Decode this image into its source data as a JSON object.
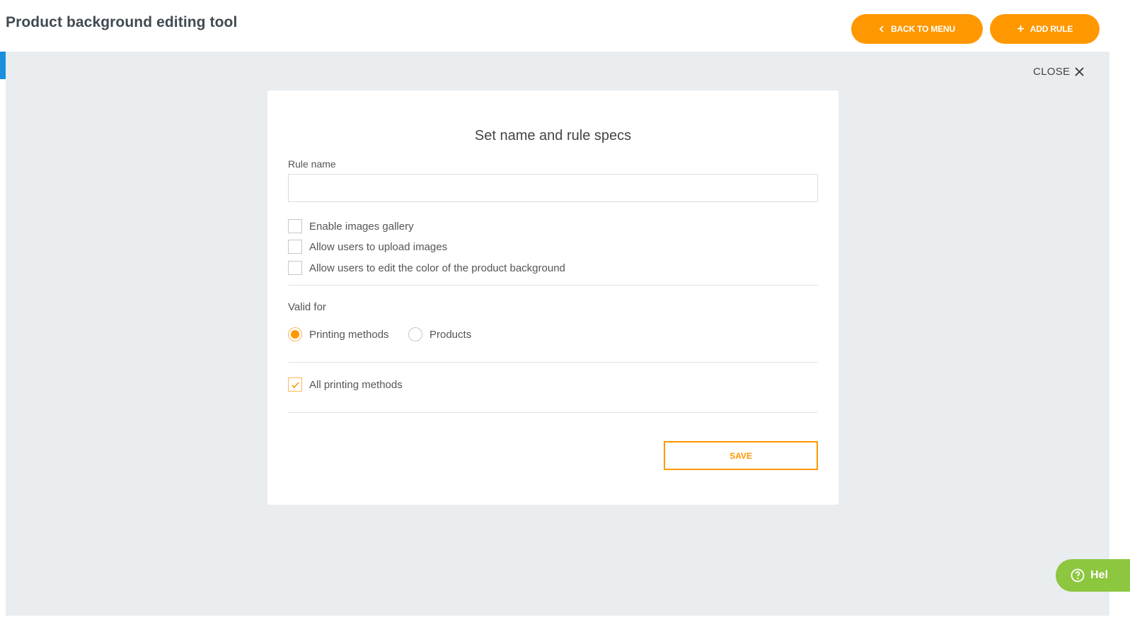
{
  "header": {
    "title": "Product background editing tool",
    "back_label": "BACK TO MENU",
    "back_icon": "chevron-left-icon",
    "add_label": "ADD RULE",
    "add_icon": "plus-icon"
  },
  "panel": {
    "close_label": "CLOSE"
  },
  "modal": {
    "title": "Set name and rule specs",
    "rule_name_label": "Rule name",
    "rule_name_value": "",
    "options": [
      {
        "label": "Enable images gallery",
        "checked": false
      },
      {
        "label": "Allow users to upload images",
        "checked": false
      },
      {
        "label": "Allow users to edit the color of the product background",
        "checked": false
      }
    ],
    "valid_for_label": "Valid for",
    "valid_for": [
      {
        "label": "Printing methods",
        "selected": true
      },
      {
        "label": "Products",
        "selected": false
      }
    ],
    "all_methods": {
      "label": "All printing methods",
      "checked": true
    },
    "save_label": "SAVE"
  },
  "help": {
    "label": "Hel"
  },
  "colors": {
    "accent": "#ff9800",
    "help": "#8dc63f",
    "side_accent": "#1a8fe0",
    "panel_bg": "#e9edf0"
  }
}
